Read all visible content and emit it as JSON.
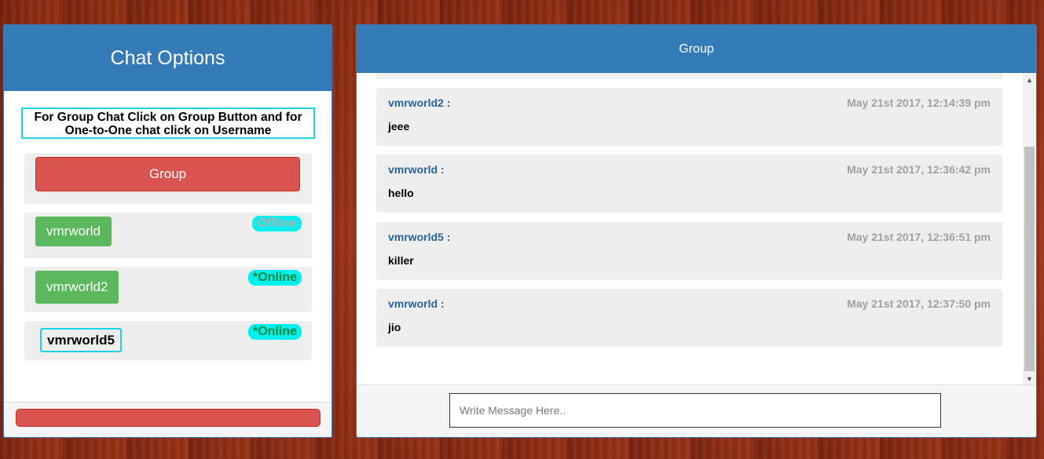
{
  "left_panel": {
    "title": "Chat Options",
    "instructions": "For Group Chat Click on Group Button and for One-to-One chat click on Username",
    "group_button": "Group",
    "users": [
      {
        "name": "vmrworld",
        "status": "Offline"
      },
      {
        "name": "vmrworld2",
        "status": "*Online"
      },
      {
        "name": "vmrworld5",
        "status": "*Online"
      }
    ]
  },
  "chat_panel": {
    "title": "Group",
    "messages": [
      {
        "user": "vmrworld2 :",
        "time": "May 21st 2017, 12:14:39 pm",
        "text": "jeee"
      },
      {
        "user": "vmrworld :",
        "time": "May 21st 2017, 12:36:42 pm",
        "text": "hello"
      },
      {
        "user": "vmrworld5 :",
        "time": "May 21st 2017, 12:36:51 pm",
        "text": "killer"
      },
      {
        "user": "vmrworld :",
        "time": "May 21st 2017, 12:37:50 pm",
        "text": "jio"
      }
    ],
    "input_placeholder": "Write Message Here.."
  },
  "colors": {
    "header_blue": "#337ab7",
    "group_red": "#d9534f",
    "user_green": "#5cb85c",
    "status_cyan": "#00f0f0"
  }
}
